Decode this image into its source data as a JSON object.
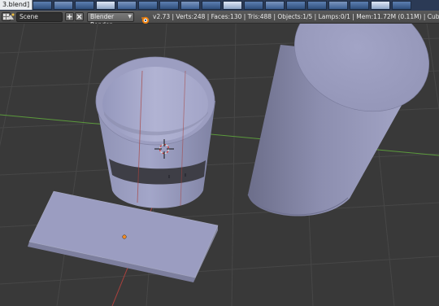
{
  "window": {
    "title_fragment": "3.blend]"
  },
  "header": {
    "editor_menu_icon": "grid-icon",
    "scene_icon": "scene-icon",
    "scene_name": "Scene",
    "add_icon": "plus-icon",
    "remove_icon": "close-icon",
    "render_engine": "Blender Render",
    "logo_icon": "blender-logo-icon",
    "stats": "v2.73 | Verts:248 | Faces:130 | Tris:488 | Objects:1/5 | Lamps:0/1 | Mem:11.72M (0.11M) | Cube"
  },
  "viewport": {
    "background": "#393939",
    "grid_color": "#474747",
    "x_axis_color": "#a8413d",
    "y_axis_color": "#5b9a3c",
    "mesh_color": "#9b9dc4",
    "origin_color": "#f08a24",
    "objects": [
      "open-cylinder-cup",
      "tall-cylinder",
      "flat-box"
    ]
  }
}
